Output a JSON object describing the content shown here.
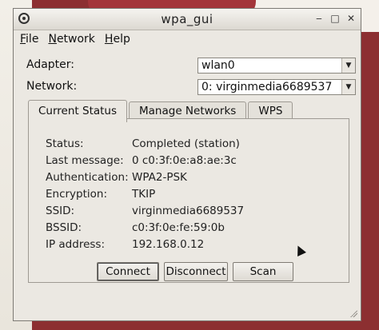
{
  "window": {
    "title": "wpa_gui",
    "controls": {
      "minimize": "‒",
      "maximize": "□",
      "close": "✕"
    }
  },
  "menu": [
    {
      "mnemonic": "F",
      "rest": "ile"
    },
    {
      "mnemonic": "N",
      "rest": "etwork"
    },
    {
      "mnemonic": "H",
      "rest": "elp"
    }
  ],
  "adapter": {
    "label": "Adapter:",
    "value": "wlan0"
  },
  "network": {
    "label": "Network:",
    "value": "0: virginmedia6689537"
  },
  "tabs": [
    {
      "label": "Current Status",
      "active": true
    },
    {
      "label": "Manage Networks",
      "active": false
    },
    {
      "label": "WPS",
      "active": false
    }
  ],
  "status": {
    "status_label": "Status:",
    "status_value": "Completed (station)",
    "last_message_label": "Last message:",
    "last_message_value": "0 c0:3f:0e:a8:ae:3c",
    "authentication_label": "Authentication:",
    "authentication_value": "WPA2-PSK",
    "encryption_label": "Encryption:",
    "encryption_value": "TKIP",
    "ssid_label": "SSID:",
    "ssid_value": "virginmedia6689537",
    "bssid_label": "BSSID:",
    "bssid_value": "c0:3f:0e:fe:59:0b",
    "ip_label": "IP address:",
    "ip_value": "192.168.0.12"
  },
  "buttons": {
    "connect": "Connect",
    "disconnect": "Disconnect",
    "scan": "Scan"
  },
  "icons": {
    "app": "wireless-icon",
    "dropdown": "chevron-down-icon"
  }
}
